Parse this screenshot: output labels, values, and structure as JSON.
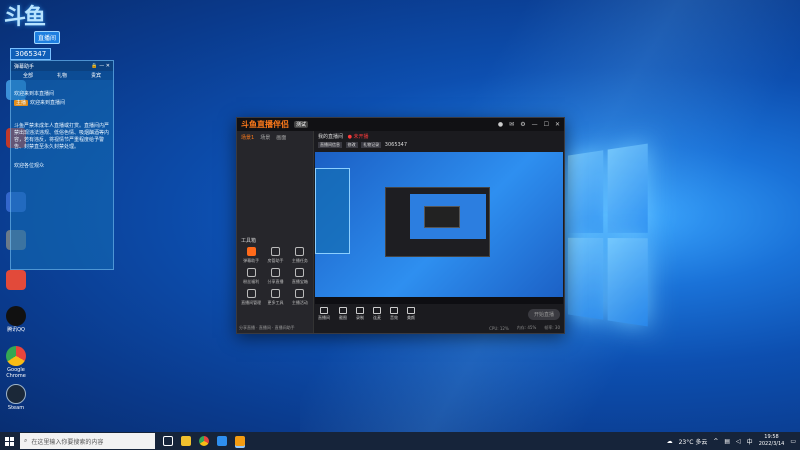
{
  "desktop": {
    "logo_text": "斗鱼",
    "logo_badge": "直播间",
    "room_number": "3065347",
    "icons": [
      {
        "label": "",
        "color": "#3a8fd8"
      },
      {
        "label": "",
        "color": "#c0392b"
      },
      {
        "label": "",
        "color": "#3366cc"
      },
      {
        "label": "",
        "color": "#6a7a8a"
      },
      {
        "label": "",
        "color": "#e24a3a"
      },
      {
        "label": "腾讯QQ",
        "color": "#111111"
      },
      {
        "label": "Google Chrome",
        "color": "#dddddd"
      },
      {
        "label": "Steam",
        "color": "#1b2838"
      }
    ]
  },
  "chat_panel": {
    "title": "弹幕助手",
    "tabs": [
      "全部",
      "礼物",
      "贵宾"
    ],
    "messages": [
      {
        "tag": "",
        "text": "欢迎来到本直播间"
      },
      {
        "tag": "主播",
        "text": "欢迎来到直播间"
      },
      {
        "tag": "",
        "text": "斗鱼严禁未成年人直播或打赏。直播间内严禁出现违法违规、低俗色情、吸烟酗酒等内容，若有违反，将视情节严重程度给予警告、封禁直至永久封禁处理。"
      },
      {
        "tag": "",
        "text": "欢迎各位观众"
      }
    ]
  },
  "app": {
    "brand": "斗鱼直播伴侣",
    "version": "测试",
    "left_tabs": [
      "场景1",
      "场景",
      "画面"
    ],
    "tools_title": "工具箱",
    "tools": [
      {
        "label": "弹幕助手",
        "active": true
      },
      {
        "label": "房管助手",
        "active": false
      },
      {
        "label": "主播任务",
        "active": false
      },
      {
        "label": "粉丝福利",
        "active": false
      },
      {
        "label": "分享直播",
        "active": false
      },
      {
        "label": "直播宝箱",
        "active": false
      },
      {
        "label": "直播间管理",
        "active": false
      },
      {
        "label": "更多工具",
        "active": false
      },
      {
        "label": "主播活动",
        "active": false
      }
    ],
    "left_footer": "分享直播 · 直播间 · 直播间助手",
    "info": {
      "room_title": "我的直播间",
      "live_status": "● 未开播",
      "tags": [
        "直播间信息",
        "修改",
        "礼物记录"
      ],
      "room_id": "3065347"
    },
    "controls": [
      "直播间",
      "截图",
      "录制",
      "连麦",
      "音效",
      "美颜"
    ],
    "start_button": "开始直播",
    "footer_items": [
      "CPU: 12%",
      "内存: 45%",
      "帧率: 30"
    ]
  },
  "taskbar": {
    "search_placeholder": "在这里输入你要搜索的内容",
    "weather": "23°C 多云",
    "time": "19:58",
    "date": "2022/3/14",
    "pinned": [
      {
        "name": "task-view",
        "color": "#ffffff"
      },
      {
        "name": "file-explorer",
        "color": "#f2c12e"
      },
      {
        "name": "chrome",
        "color": "#e8453c"
      },
      {
        "name": "app-blue",
        "color": "#2e8ff0"
      },
      {
        "name": "douyu",
        "color": "#f39c12"
      }
    ]
  }
}
